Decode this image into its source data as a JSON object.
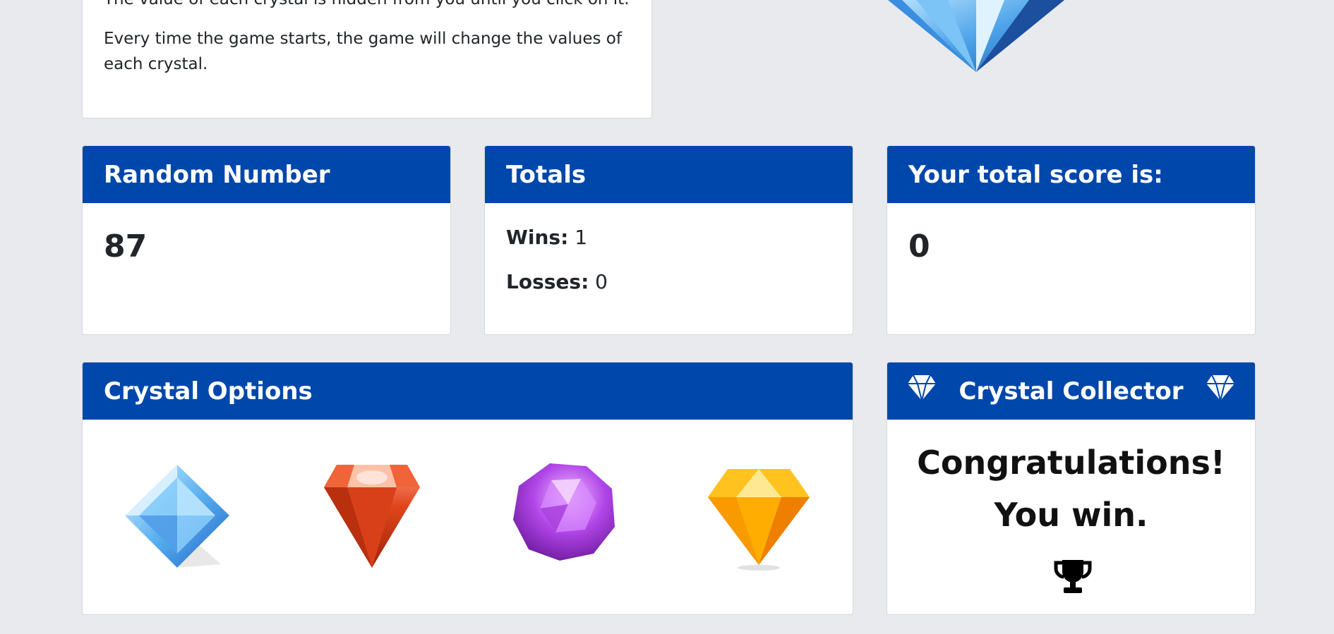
{
  "intro": {
    "line1": "The value of each crystal is hidden from you until you click on it.",
    "line2": "Every time the game starts, the game will change the values of each crystal."
  },
  "random_number": {
    "title": "Random Number",
    "value": "87"
  },
  "totals": {
    "title": "Totals",
    "wins_label": "Wins:",
    "wins_value": "1",
    "losses_label": "Losses:",
    "losses_value": "0"
  },
  "score": {
    "title": "Your total score is:",
    "value": "0"
  },
  "crystal_options": {
    "title": "Crystal Options",
    "crystals": [
      "blue-crystal-icon",
      "red-crystal-icon",
      "purple-crystal-icon",
      "yellow-crystal-icon"
    ]
  },
  "collector": {
    "title": "Crystal Collector",
    "message1": "Congratulations!",
    "message2": "You win.",
    "icon": "trophy-icon"
  },
  "colors": {
    "header": "#0047ab",
    "background": "#e9eaee"
  }
}
